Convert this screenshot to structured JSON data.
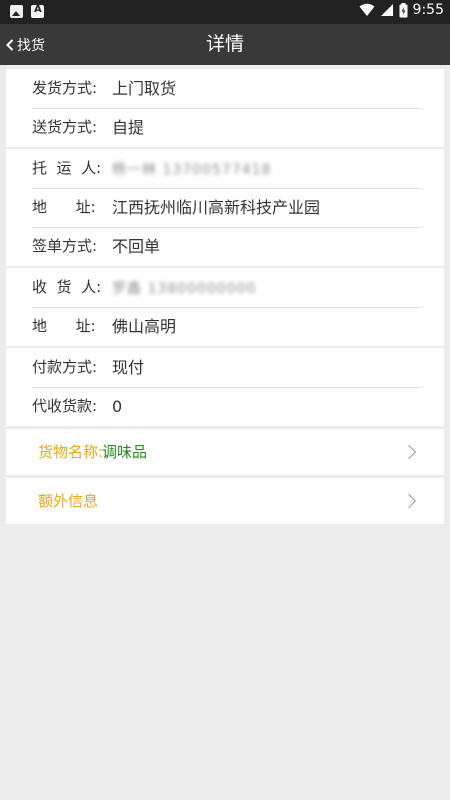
{
  "status_bar": {
    "time": "9:55"
  },
  "header": {
    "back_label": "找货",
    "title": "详情"
  },
  "delivery": {
    "ship_method_label": "发货方式:",
    "ship_method_value": "上门取货",
    "send_method_label": "送货方式:",
    "send_method_value": "自提"
  },
  "shipper": {
    "consignor_label": "托  运  人:",
    "consignor_value": "杨一林  13700577418",
    "address_label": "地      址:",
    "address_value": "江西抚州临川高新科技产业园",
    "sign_label": "签单方式:",
    "sign_value": "不回单"
  },
  "receiver": {
    "receiver_label": "收  货  人:",
    "receiver_value": "罗鑫  13800000000",
    "address_label": "地      址:",
    "address_value": "佛山高明"
  },
  "payment": {
    "pay_label": "付款方式:",
    "pay_value": "现付",
    "cod_label": "代收货款:",
    "cod_value": "0"
  },
  "goods": {
    "label": "货物名称:",
    "value": "调味品"
  },
  "extra": {
    "label": "额外信息"
  },
  "colors": {
    "accent_label": "#e9a916",
    "goods_value": "#2a8a1e",
    "header_bg": "#393939",
    "status_bg": "#222222"
  }
}
